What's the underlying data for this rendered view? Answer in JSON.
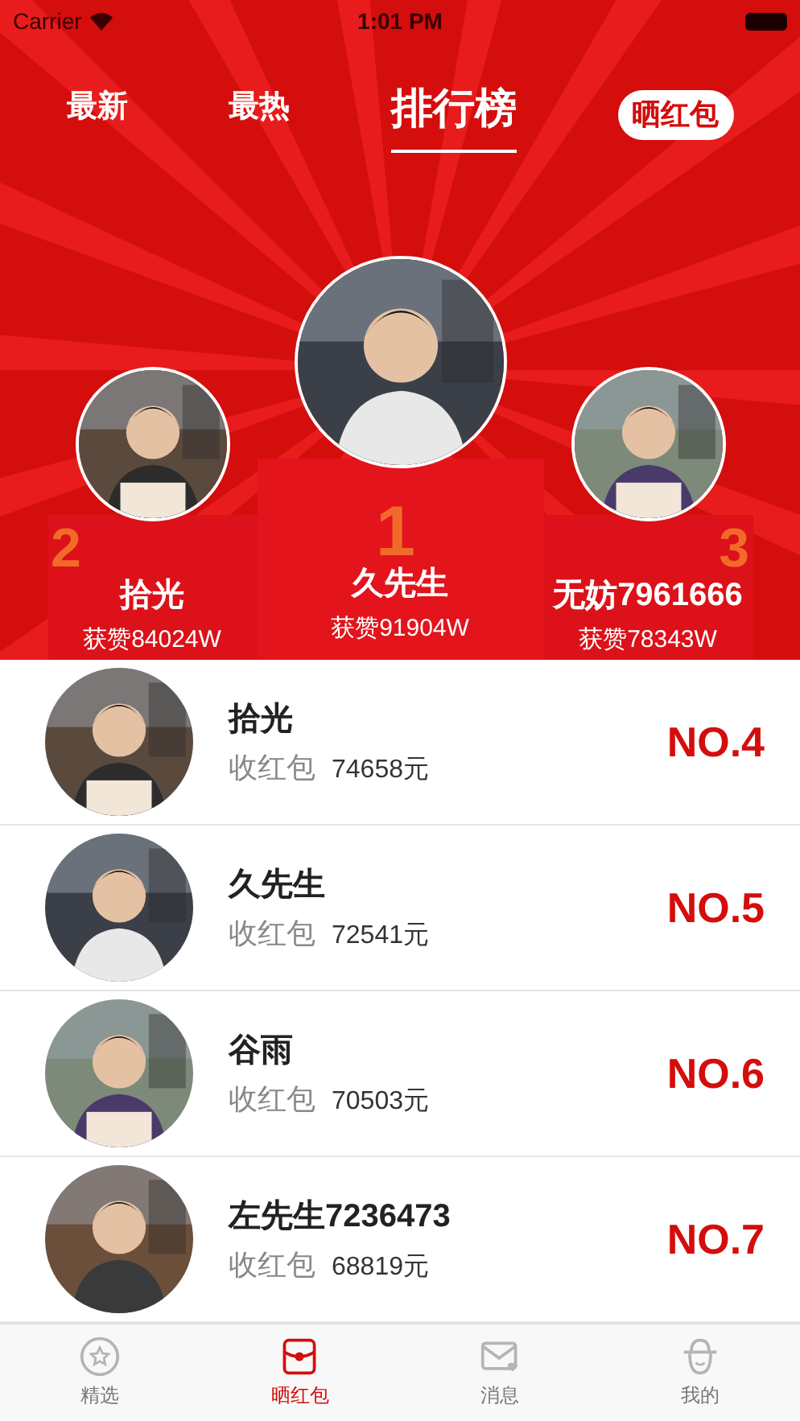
{
  "status_bar": {
    "carrier": "Carrier",
    "time": "1:01 PM"
  },
  "tabs": [
    {
      "label": "最新",
      "kind": "tab",
      "selected": false
    },
    {
      "label": "最热",
      "kind": "tab",
      "selected": false
    },
    {
      "label": "排行榜",
      "kind": "tab",
      "selected": true
    },
    {
      "label": "晒红包",
      "kind": "pill",
      "selected": false
    }
  ],
  "podium": [
    {
      "rank": "2",
      "name": "拾光",
      "likes": "获赞84024W"
    },
    {
      "rank": "1",
      "name": "久先生",
      "likes": "获赞91904W"
    },
    {
      "rank": "3",
      "name": "无妨7961666",
      "likes": "获赞78343W"
    }
  ],
  "ranking": [
    {
      "name": "拾光",
      "label": "收红包",
      "amount": "74658元",
      "rank": "NO.4"
    },
    {
      "name": "久先生",
      "label": "收红包",
      "amount": "72541元",
      "rank": "NO.5"
    },
    {
      "name": "谷雨",
      "label": "收红包",
      "amount": "70503元",
      "rank": "NO.6"
    },
    {
      "name": "左先生7236473",
      "label": "收红包",
      "amount": "68819元",
      "rank": "NO.7"
    }
  ],
  "tab_bar": [
    {
      "label": "精选",
      "kind": "star",
      "selected": false
    },
    {
      "label": "晒红包",
      "kind": "packet",
      "selected": true
    },
    {
      "label": "消息",
      "kind": "mail",
      "selected": false
    },
    {
      "label": "我的",
      "kind": "hat",
      "selected": false
    }
  ]
}
